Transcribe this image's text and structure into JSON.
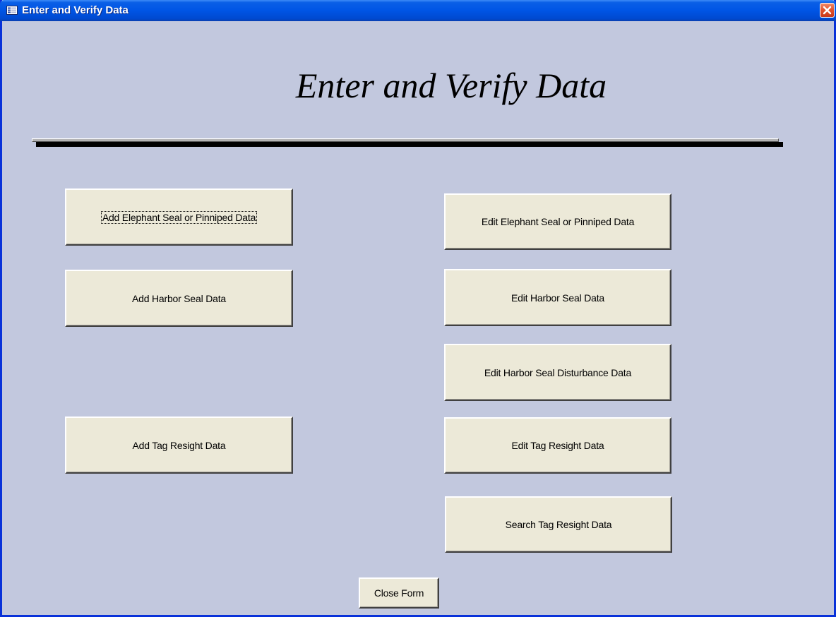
{
  "window": {
    "title": "Enter and Verify Data",
    "title_bar_color": "#0055e5",
    "background_color": "#c2c8de",
    "icons": {
      "app": "form-icon",
      "close": "close-icon"
    }
  },
  "form": {
    "heading": "Enter and Verify Data"
  },
  "buttons": {
    "add_elephant_seal": "Add Elephant Seal or Pinniped Data",
    "add_harbor_seal": "Add Harbor Seal Data",
    "add_tag_resight": "Add Tag Resight Data",
    "edit_elephant_seal": "Edit Elephant Seal or Pinniped Data",
    "edit_harbor_seal": "Edit Harbor Seal Data",
    "edit_harbor_seal_disturbance": "Edit Harbor Seal Disturbance Data",
    "edit_tag_resight": "Edit Tag Resight Data",
    "search_tag_resight": "Search Tag Resight Data",
    "close_form": "Close Form"
  }
}
